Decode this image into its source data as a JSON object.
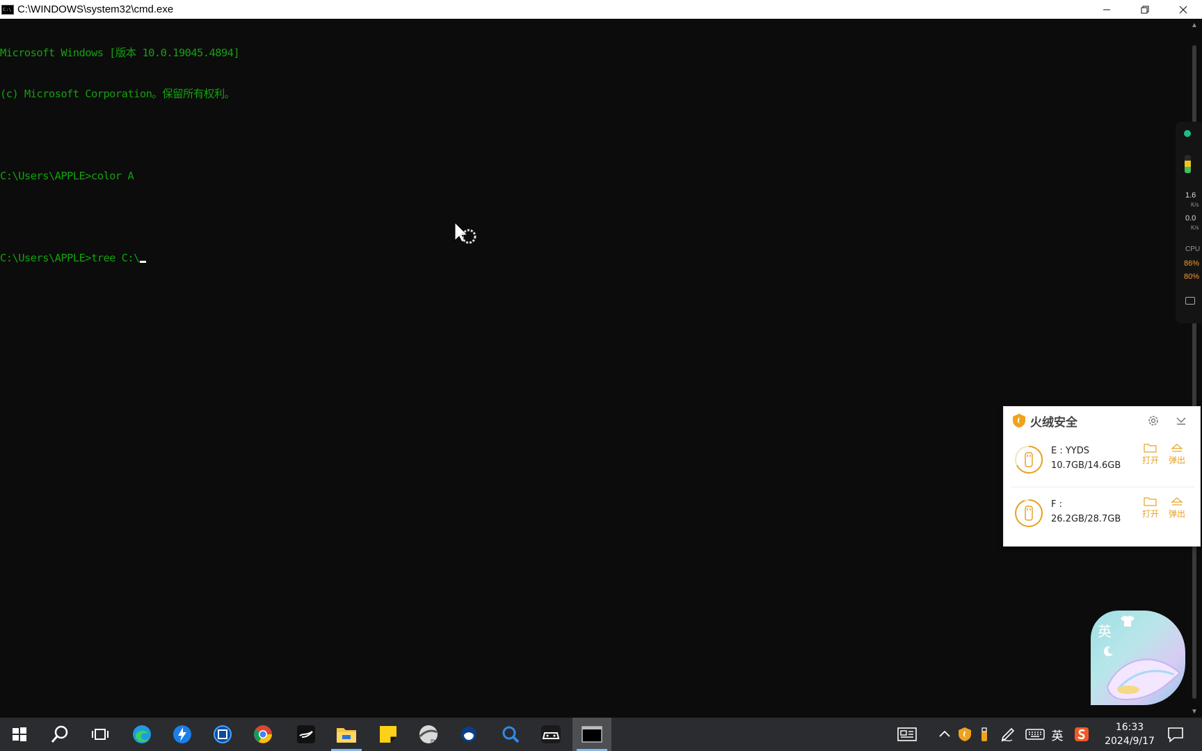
{
  "window": {
    "title": "C:\\WINDOWS\\system32\\cmd.exe",
    "icon_text": "C:\\",
    "minimize_icon": "minimize-icon",
    "maximize_icon": "restore-icon",
    "close_icon": "close-icon"
  },
  "console": {
    "text_color": "#13a10e",
    "background": "#0c0c0c",
    "lines": [
      "Microsoft Windows [版本 10.0.19045.4894]",
      "(c) Microsoft Corporation。保留所有权利。",
      "",
      "C:\\Users\\APPLE>color A",
      "",
      "C:\\Users\\APPLE>tree C:\\"
    ]
  },
  "monitor": {
    "upload": "1.6",
    "upload_unit": "K/s",
    "download": "0.0",
    "download_unit": "K/s",
    "cpu_label": "CPU",
    "cpu": "86%",
    "mem": "80%"
  },
  "security_popup": {
    "title": "火绒安全",
    "accent": "#e8a224",
    "drives": [
      {
        "name": "E : YYDS",
        "size": "10.7GB/14.6GB",
        "open_label": "打开",
        "eject_label": "弹出"
      },
      {
        "name": "F :",
        "size": "26.2GB/28.7GB",
        "open_label": "打开",
        "eject_label": "弹出"
      }
    ]
  },
  "ime": {
    "mode": "英"
  },
  "taskbar": {
    "apps": [
      "windows-start-icon",
      "search-icon",
      "task-view-icon",
      "edge-icon",
      "thunder-icon",
      "app-icon",
      "chrome-icon",
      "typora-icon",
      "file-explorer-icon",
      "sticky-notes-icon",
      "pro-app-icon",
      "blue-app-icon",
      "magnifier-icon",
      "game-controller-icon",
      "cmd-icon"
    ],
    "tray": {
      "input_lang": "英",
      "time": "16:33",
      "date": "2024/9/17"
    }
  }
}
